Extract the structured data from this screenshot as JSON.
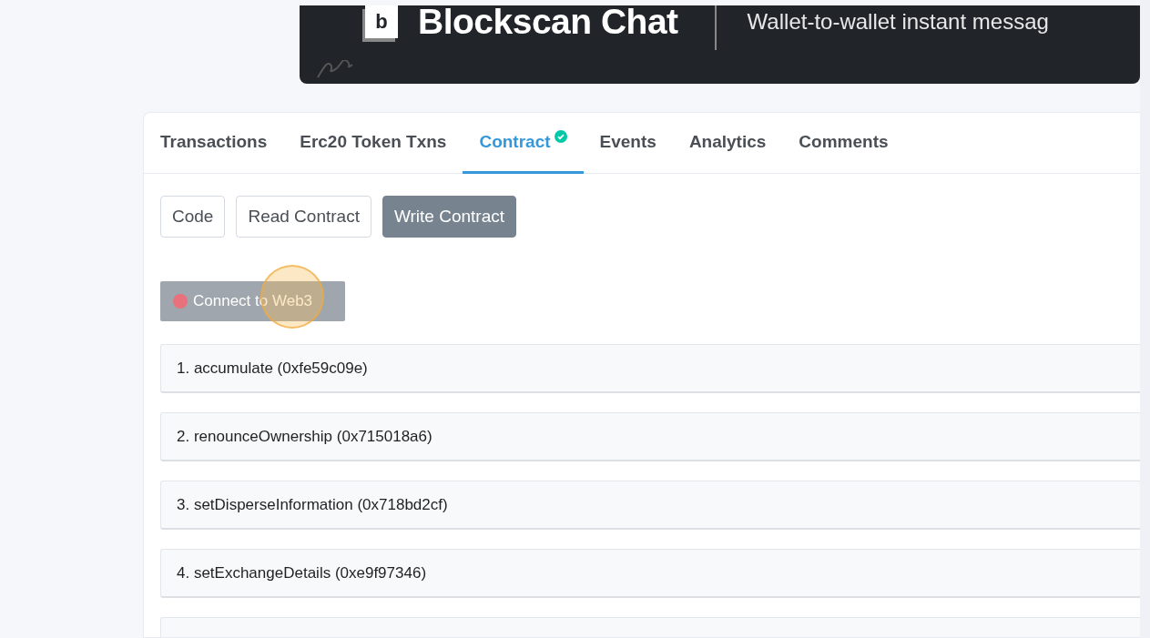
{
  "banner": {
    "logo_letter": "b",
    "title": "Blockscan Chat",
    "tagline": "Wallet-to-wallet instant messag"
  },
  "tabs": [
    {
      "label": "Transactions",
      "selected": false,
      "verified": false
    },
    {
      "label": "Erc20 Token Txns",
      "selected": false,
      "verified": false
    },
    {
      "label": "Contract",
      "selected": true,
      "verified": true
    },
    {
      "label": "Events",
      "selected": false,
      "verified": false
    },
    {
      "label": "Analytics",
      "selected": false,
      "verified": false
    },
    {
      "label": "Comments",
      "selected": false,
      "verified": false
    }
  ],
  "subtabs": [
    {
      "label": "Code",
      "selected": false
    },
    {
      "label": "Read Contract",
      "selected": false
    },
    {
      "label": "Write Contract",
      "selected": true
    }
  ],
  "connect_button": {
    "label": "Connect to Web3",
    "connected": false
  },
  "functions": [
    {
      "kind": "function",
      "label": "1. accumulate (0xfe59c09e)"
    },
    {
      "kind": "function",
      "label": "2. renounceOwnership (0x715018a6)"
    },
    {
      "kind": "function",
      "label": "3. setDisperseInformation (0x718bd2cf)"
    },
    {
      "kind": "function",
      "label": "4. setExchangeDetails (0xe9f97346)"
    },
    {
      "kind": "cut"
    }
  ]
}
